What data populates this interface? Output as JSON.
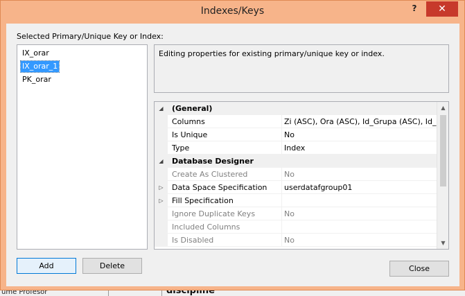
{
  "window": {
    "title": "Indexes/Keys",
    "help_glyph": "?",
    "close_glyph": "✕"
  },
  "list": {
    "label": "Selected Primary/Unique Key or Index:",
    "items": [
      {
        "label": "IX_orar",
        "selected": false
      },
      {
        "label": "IX_orar_1",
        "selected": true
      },
      {
        "label": "PK_orar",
        "selected": false
      }
    ]
  },
  "description": "Editing properties for existing primary/unique key or index.",
  "properties": [
    {
      "kind": "category",
      "expander": "◢",
      "name": "(General)"
    },
    {
      "kind": "prop",
      "name": "Columns",
      "value": "Zi (ASC), Ora (ASC), Id_Grupa (ASC), Id_Discipl"
    },
    {
      "kind": "prop",
      "name": "Is Unique",
      "value": "No"
    },
    {
      "kind": "prop",
      "name": "Type",
      "value": "Index"
    },
    {
      "kind": "category",
      "expander": "◢",
      "name": "Database Designer"
    },
    {
      "kind": "prop",
      "disabled": true,
      "name": "Create As Clustered",
      "value": "No"
    },
    {
      "kind": "prop",
      "expander": "▷",
      "name": "Data Space Specification",
      "value": "userdatafgroup01"
    },
    {
      "kind": "prop",
      "expander": "▷",
      "name": "Fill Specification",
      "value": ""
    },
    {
      "kind": "prop",
      "disabled": true,
      "name": "Ignore Duplicate Keys",
      "value": "No"
    },
    {
      "kind": "prop",
      "disabled": true,
      "name": "Included Columns",
      "value": ""
    },
    {
      "kind": "prop",
      "disabled": true,
      "name": "Is Disabled",
      "value": "No"
    }
  ],
  "scrollbar": {
    "up": "▲",
    "down": "▼"
  },
  "buttons": {
    "add": "Add",
    "delete": "Delete",
    "close": "Close"
  },
  "background": {
    "bottom_left_text": "ume Profesor",
    "bottom_bold_text": "discipline"
  },
  "colors": {
    "title_bar": "#f7b48a",
    "close_button": "#c7392b",
    "selection": "#3399ff"
  }
}
